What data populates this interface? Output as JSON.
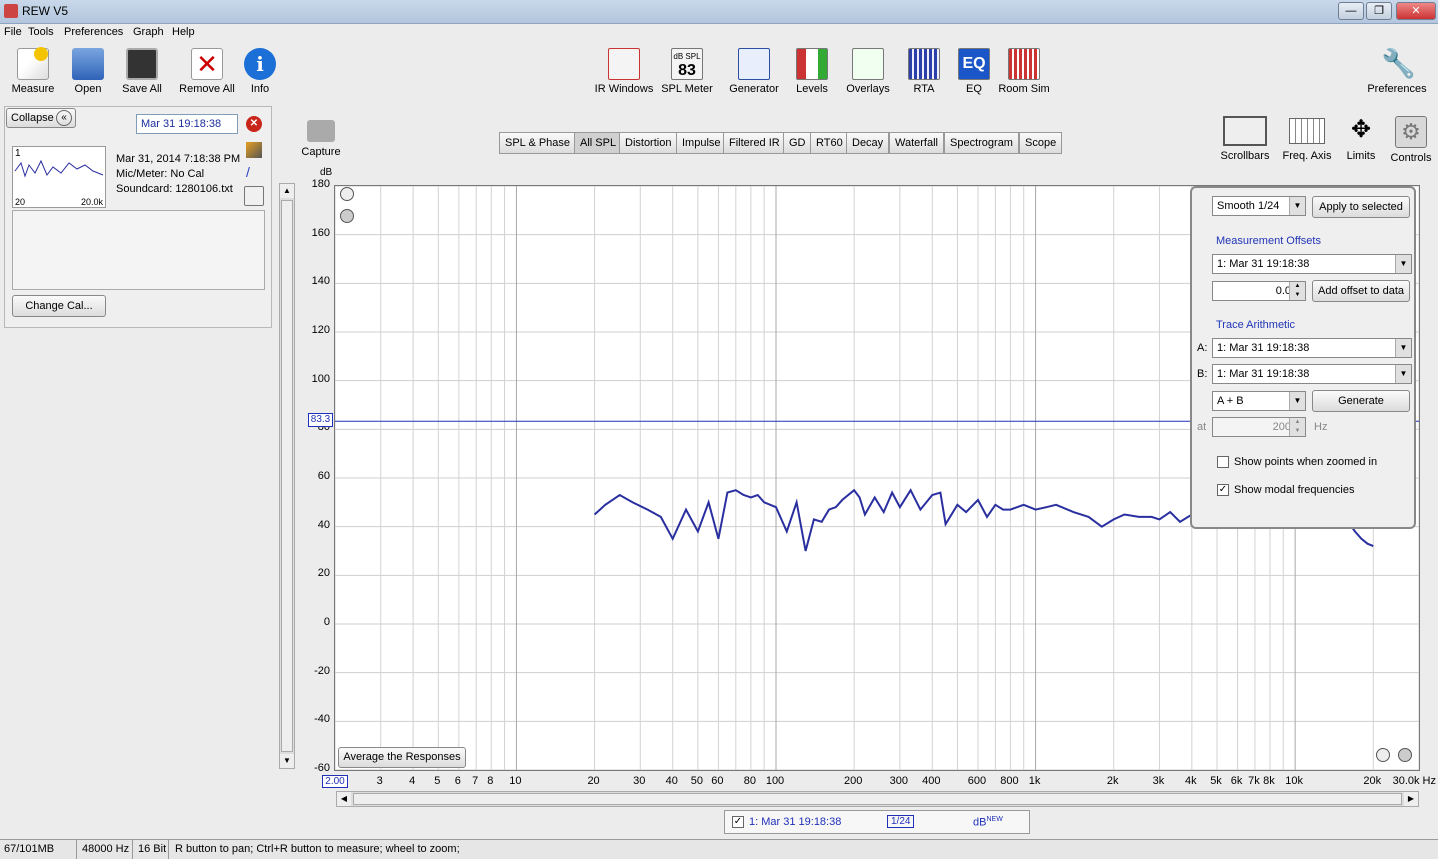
{
  "window": {
    "title": "REW V5",
    "min": "—",
    "max": "❐",
    "close": "✕"
  },
  "menu": [
    "File",
    "Tools",
    "Preferences",
    "Graph",
    "Help"
  ],
  "toolbar": {
    "left": [
      {
        "label": "Measure"
      },
      {
        "label": "Open"
      },
      {
        "label": "Save All"
      },
      {
        "label": "Remove All"
      },
      {
        "label": "Info"
      }
    ],
    "middle": [
      {
        "label": "IR Windows"
      },
      {
        "label": "SPL Meter",
        "top": "dB SPL",
        "value": "83"
      },
      {
        "label": "Generator"
      },
      {
        "label": "Levels"
      },
      {
        "label": "Overlays"
      },
      {
        "label": "RTA"
      },
      {
        "label": "EQ",
        "icon_text": "EQ"
      },
      {
        "label": "Room Sim"
      }
    ],
    "preferences": "Preferences"
  },
  "left_panel": {
    "collapse": "Collapse",
    "measurement_name": "Mar 31 19:18:38",
    "thumb_index": "1",
    "thumb_xmin": "20",
    "thumb_xmax": "20.0k",
    "date": "Mar 31, 2014 7:18:38 PM",
    "mic": "Mic/Meter: No Cal",
    "soundcard": "Soundcard: 1280106.txt",
    "change_cal": "Change Cal..."
  },
  "capture": "Capture",
  "tabs": [
    "SPL & Phase",
    "All SPL",
    "Distortion",
    "Impulse",
    "Filtered IR",
    "GD",
    "RT60",
    "Decay",
    "Waterfall",
    "Spectrogram",
    "Scope"
  ],
  "active_tab": "All SPL",
  "graph_tools": [
    "Scrollbars",
    "Freq. Axis",
    "Limits",
    "Controls"
  ],
  "chart_data": {
    "type": "line",
    "ylabel": "dB",
    "ylim": [
      -60,
      180
    ],
    "y_ticks": [
      "180",
      "160",
      "140",
      "120",
      "100",
      "80",
      "60",
      "40",
      "20",
      "0",
      "-20",
      "-40",
      "-60"
    ],
    "xlim": [
      2,
      30000
    ],
    "x_scale": "log",
    "x_ticks": [
      "2.00",
      "3",
      "4",
      "5",
      "6",
      "7",
      "8",
      "10",
      "20",
      "30",
      "40",
      "50",
      "60",
      "80",
      "100",
      "200",
      "300",
      "400",
      "600",
      "800",
      "1k",
      "2k",
      "3k",
      "4k",
      "5k",
      "6k",
      "7k",
      "8k",
      "10k",
      "20k",
      "30.0k Hz"
    ],
    "cursor_level": "83.3",
    "cursor_db": 83.3,
    "series": [
      {
        "name": "1: Mar 31 19:18:38",
        "color": "#2a2fa0",
        "x": [
          20,
          22,
          25,
          28,
          32,
          36,
          40,
          45,
          50,
          55,
          60,
          65,
          70,
          75,
          80,
          85,
          90,
          100,
          110,
          120,
          130,
          140,
          150,
          160,
          170,
          180,
          200,
          210,
          220,
          240,
          260,
          280,
          300,
          330,
          360,
          400,
          430,
          450,
          500,
          540,
          600,
          650,
          700,
          750,
          800,
          900,
          1000,
          1100,
          1200,
          1400,
          1600,
          1800,
          2000,
          2200,
          2500,
          2800,
          3000,
          3300,
          3600,
          4000,
          4500,
          5000,
          5500,
          6000,
          6500,
          7000,
          7500,
          8000,
          9000,
          10000,
          11000,
          12000,
          13000,
          14000,
          15000,
          16000,
          17000,
          18000,
          19000,
          20000
        ],
        "y": [
          45,
          49,
          53,
          50,
          47,
          44,
          35,
          47,
          38,
          50,
          35,
          54,
          55,
          53,
          52,
          53,
          50,
          48,
          38,
          50,
          30,
          43,
          42,
          47,
          48,
          51,
          55,
          52,
          45,
          52,
          46,
          54,
          48,
          55,
          47,
          53,
          54,
          41,
          49,
          46,
          51,
          44,
          49,
          47,
          47,
          49,
          47,
          48,
          49,
          46,
          44,
          40,
          43,
          45,
          44,
          44,
          43,
          46,
          42,
          45,
          47,
          45,
          46,
          47,
          46,
          45,
          44,
          45,
          45,
          46,
          44,
          46,
          47,
          48,
          46,
          42,
          38,
          35,
          33,
          32
        ]
      }
    ],
    "legend_item": "1: Mar 31 19:18:38",
    "legend_smooth": "1/24",
    "legend_unit": "dB",
    "legend_unit_sup": "NEW"
  },
  "graph_buttons": {
    "average": "Average the Responses"
  },
  "controls": {
    "smoothing": "Smooth 1/24",
    "apply": "Apply to selected",
    "offsets_title": "Measurement Offsets",
    "offset_meas": "1: Mar 31 19:18:38",
    "offset_value": "0.0",
    "add_offset": "Add offset to data",
    "arith_title": "Trace Arithmetic",
    "a_label": "A:",
    "a_value": "1: Mar 31 19:18:38",
    "b_label": "B:",
    "b_value": "1: Mar 31 19:18:38",
    "op": "A + B",
    "generate": "Generate",
    "at_label": "at",
    "at_value": "200",
    "at_unit": "Hz",
    "show_points": "Show points when zoomed in",
    "show_modal": "Show modal frequencies"
  },
  "status": {
    "memory": "67/101MB",
    "rate": "48000 Hz",
    "bits": "16 Bit",
    "hint": "R button to pan; Ctrl+R button to measure; wheel to zoom;"
  }
}
